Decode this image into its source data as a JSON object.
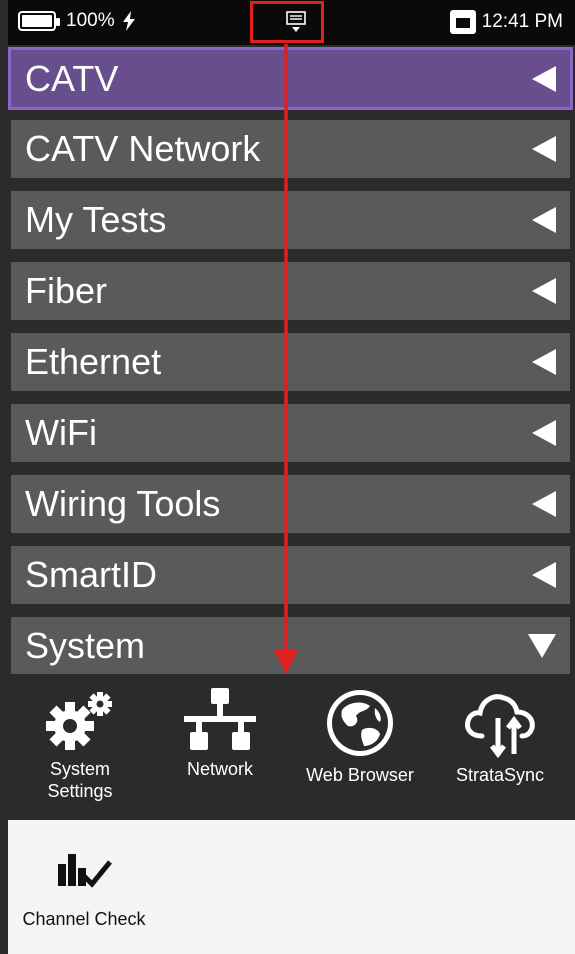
{
  "status_bar": {
    "battery_percent": "100%",
    "time": "12:41 PM"
  },
  "menu": {
    "items": [
      {
        "label": "CATV",
        "state": "active",
        "arrow": "left"
      },
      {
        "label": "CATV Network",
        "arrow": "left"
      },
      {
        "label": "My Tests",
        "arrow": "left"
      },
      {
        "label": "Fiber",
        "arrow": "left"
      },
      {
        "label": "Ethernet",
        "arrow": "left"
      },
      {
        "label": "WiFi",
        "arrow": "left"
      },
      {
        "label": "Wiring Tools",
        "arrow": "left"
      },
      {
        "label": "SmartID",
        "arrow": "left"
      },
      {
        "label": "System",
        "arrow": "down"
      }
    ]
  },
  "apps": [
    {
      "label": "System Settings",
      "icon": "gear-icon"
    },
    {
      "label": "Network",
      "icon": "network-icon"
    },
    {
      "label": "Web Browser",
      "icon": "globe-icon"
    },
    {
      "label": "StrataSync",
      "icon": "cloud-sync-icon"
    }
  ],
  "panel": {
    "apps": [
      {
        "label": "Channel Check",
        "icon": "channel-check-icon"
      }
    ]
  },
  "colors": {
    "active_item": "#684e8c",
    "item": "#5a5a5a",
    "annotation": "#e02020"
  }
}
